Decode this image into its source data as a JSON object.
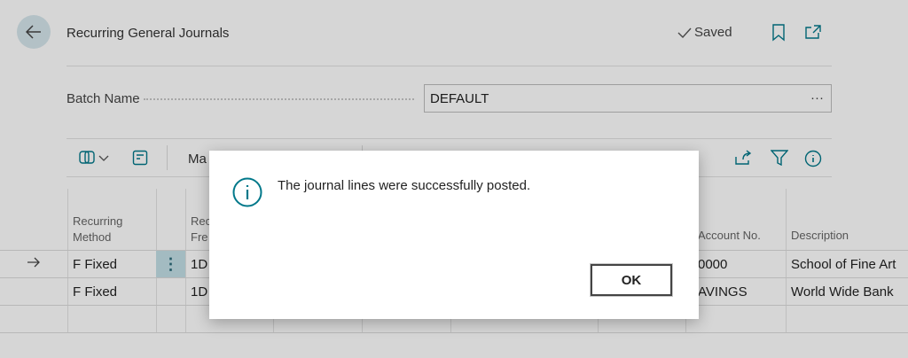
{
  "header": {
    "title": "Recurring General Journals",
    "saved_label": "Saved"
  },
  "batch": {
    "label": "Batch Name",
    "value": "DEFAULT",
    "more": "···"
  },
  "actions": {
    "partial_label": "Ma"
  },
  "columns": {
    "recurring_method": "Recurring Method",
    "recurring_frequency_partial": "Rec Fre",
    "account_no": "Account No.",
    "description": "Description"
  },
  "rows": [
    {
      "method": "F Fixed",
      "freq": "1D",
      "account": "0000",
      "description": "School of Fine Art",
      "current": true
    },
    {
      "method": "F  Fixed",
      "freq": "1D",
      "account": "AVINGS",
      "description": "World Wide Bank",
      "current": false
    },
    {
      "method": "",
      "freq": "",
      "account": "",
      "description": "",
      "current": false
    }
  ],
  "dialog": {
    "message": "The journal lines were successfully posted.",
    "ok_label": "OK"
  },
  "colors": {
    "accent": "#00788a",
    "back_bg": "#d6e6ec",
    "selected_cell": "#c3dfe6"
  }
}
